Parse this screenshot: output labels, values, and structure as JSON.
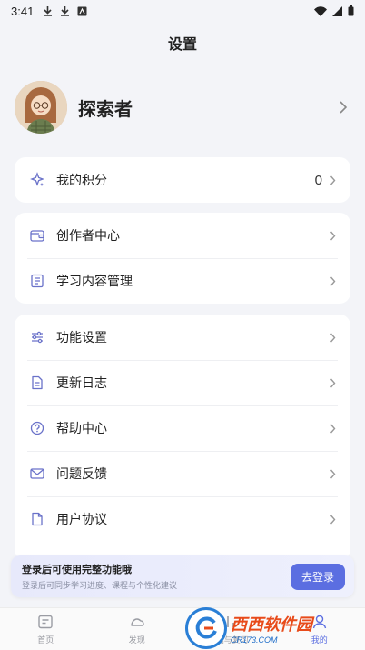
{
  "status_bar": {
    "time": "3:41"
  },
  "header": {
    "title": "设置"
  },
  "profile": {
    "name": "探索者"
  },
  "points": {
    "label": "我的积分",
    "value": "0"
  },
  "group1": [
    {
      "label": "创作者中心",
      "icon": "wallet-icon"
    },
    {
      "label": "学习内容管理",
      "icon": "document-icon"
    }
  ],
  "group2": [
    {
      "label": "功能设置",
      "icon": "sliders-icon"
    },
    {
      "label": "更新日志",
      "icon": "file-icon"
    },
    {
      "label": "帮助中心",
      "icon": "help-icon"
    },
    {
      "label": "问题反馈",
      "icon": "mail-icon"
    },
    {
      "label": "用户协议",
      "icon": "page-icon"
    }
  ],
  "login_banner": {
    "title": "登录后可使用完整功能哦",
    "subtitle": "登录后可同步学习进度、课程与个性化建议",
    "button": "去登录"
  },
  "tabbar": [
    {
      "label": "首页",
      "icon": "home-icon"
    },
    {
      "label": "发现",
      "icon": "discover-icon"
    },
    {
      "label": "数据与复习",
      "icon": "data-icon"
    },
    {
      "label": "我的",
      "icon": "profile-icon",
      "active": true
    }
  ],
  "watermark": {
    "brand": "西西软件园",
    "site": "CR173.COM"
  },
  "colors": {
    "accent": "#5b6ee1",
    "icon": "#6a72c9",
    "background": "#f3f4f8"
  }
}
